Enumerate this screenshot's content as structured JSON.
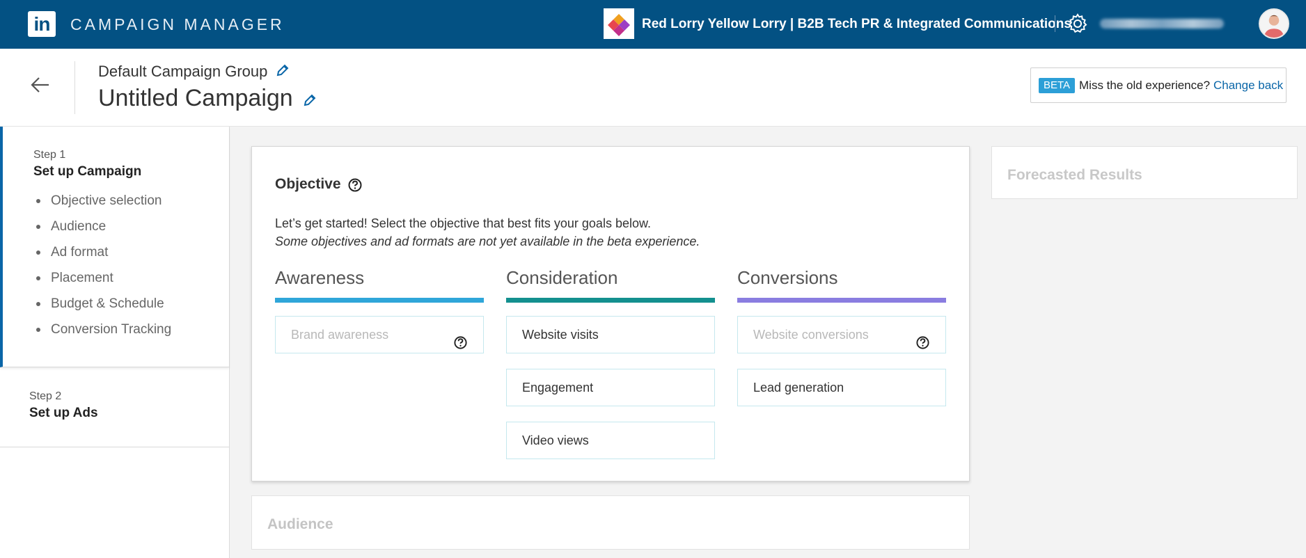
{
  "topbar": {
    "logo_text": "in",
    "app_title": "CAMPAIGN MANAGER",
    "account_name": "Red Lorry Yellow Lorry | B2B Tech PR & Integrated Communications",
    "icons": [
      "linkedin-logo-icon",
      "account-logo-icon",
      "gear-icon",
      "avatar"
    ]
  },
  "header": {
    "campaign_group": "Default Campaign Group",
    "campaign_name": "Untitled Campaign",
    "beta": {
      "tag": "BETA",
      "text": "Miss the old experience?",
      "link": "Change back"
    }
  },
  "sidebar": {
    "step1": {
      "label": "Step 1",
      "title": "Set up Campaign",
      "items": [
        "Objective selection",
        "Audience",
        "Ad format",
        "Placement",
        "Budget & Schedule",
        "Conversion Tracking"
      ]
    },
    "step2": {
      "label": "Step 2",
      "title": "Set up Ads"
    }
  },
  "objective": {
    "title": "Objective",
    "intro": "Let’s get started! Select the objective that best fits your goals below.",
    "intro_note": "Some objectives and ad formats are not yet available in the beta experience.",
    "columns": [
      {
        "title": "Awareness",
        "color": "#2fa6d9",
        "options": [
          {
            "label": "Brand awareness",
            "disabled": true,
            "help": true
          }
        ]
      },
      {
        "title": "Consideration",
        "color": "#13908f",
        "options": [
          {
            "label": "Website visits"
          },
          {
            "label": "Engagement"
          },
          {
            "label": "Video views"
          }
        ]
      },
      {
        "title": "Conversions",
        "color": "#8a7de0",
        "options": [
          {
            "label": "Website conversions",
            "disabled": true,
            "help": true
          },
          {
            "label": "Lead generation"
          }
        ]
      }
    ]
  },
  "audience": {
    "title": "Audience"
  },
  "forecast": {
    "title": "Forecasted Results"
  },
  "colors": {
    "topbar": "#035183",
    "accent": "#0a66a8",
    "beta_tag": "#2c9fd7"
  }
}
